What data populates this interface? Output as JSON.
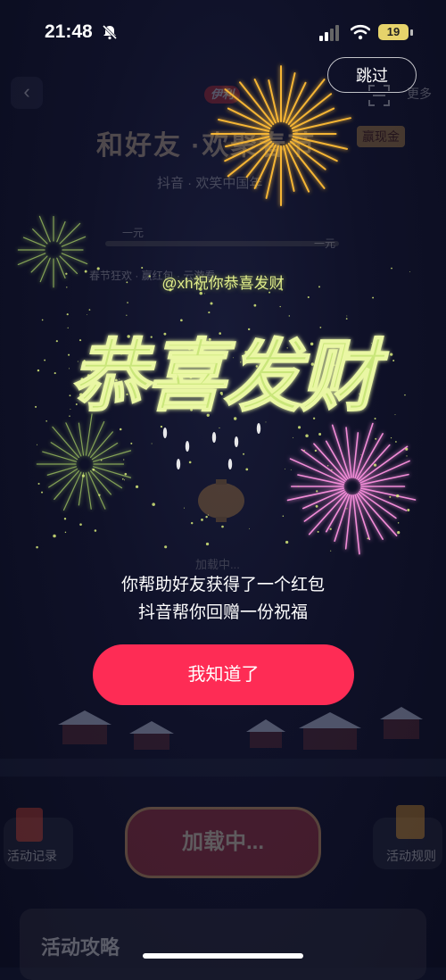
{
  "status_bar": {
    "time": "21:48",
    "battery": "19"
  },
  "skip_label": "跳过",
  "background_page": {
    "back_glyph": "‹",
    "brand": "伊利",
    "title": "和好友 ·欢聚春节",
    "prize_badge": "赢现金",
    "more_label": "更多",
    "subtitle": "抖音 · 欢笑中国年",
    "progress_left": "一元",
    "progress_right": "一元",
    "tip": "春节狂欢 · 赢红包 · 云游看",
    "loading_small": "加载中...",
    "records_label": "活动记录",
    "rules_label": "活动规则",
    "loading_button": "加载中...",
    "guide_label": "活动攻略"
  },
  "greeting": "@xh祝你恭喜发财",
  "blessing_art": "恭喜发财",
  "message_line1": "你帮助好友获得了一个红包",
  "message_line2": "抖音帮你回赠一份祝福",
  "ok_button": "我知道了",
  "colors": {
    "accent": "#fe2c55",
    "greeting": "#dfeb8a",
    "firework_gold": "#f5b534",
    "firework_pink": "#f28cd8"
  },
  "icons": [
    "bell-muted-icon",
    "cellular-signal-icon",
    "wifi-icon",
    "battery-icon",
    "back-arrow-icon",
    "scan-icon",
    "douyin-logo-icon",
    "lantern-icon",
    "red-packet-icon",
    "rules-icon"
  ]
}
